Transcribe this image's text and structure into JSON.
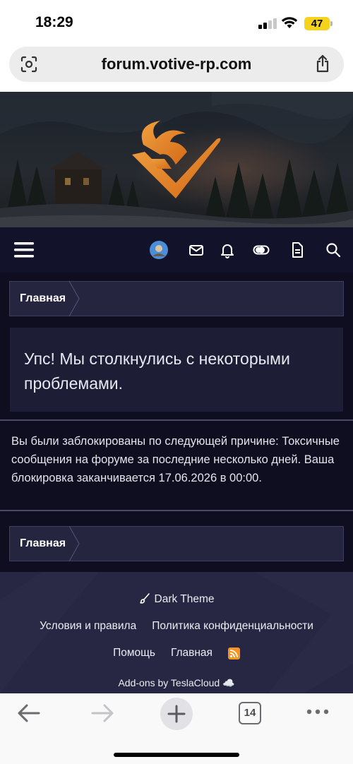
{
  "status_bar": {
    "time": "18:29",
    "battery": "47",
    "battery_color": "#f5d21c"
  },
  "browser": {
    "url": "forum.votive-rp.com",
    "left_icon": "page-scan-icon",
    "right_icon": "share-icon",
    "tab_count": "14"
  },
  "site": {
    "logo": "phoenix-shield-logo",
    "logo_color": "#e8862a",
    "nav_icons": [
      "menu-icon",
      "avatar",
      "envelope-icon",
      "bell-icon",
      "theme-toggle-icon",
      "document-icon",
      "search-icon"
    ],
    "breadcrumb_top": "Главная",
    "error_title": "Упс! Мы столкнулись с некоторыми проблемами.",
    "ban_message": "Вы были заблокированы по следующей причине: Токсичные сообщения на форуме за последние несколько дней. Ваша блокировка заканчивается 17.06.2026 в 00:00.",
    "breadcrumb_bottom": "Главная"
  },
  "footer": {
    "theme_label": "Dark Theme",
    "terms": "Условия и правила",
    "privacy": "Политика конфиденциальности",
    "help": "Помощь",
    "home": "Главная",
    "addons": "Add-ons by TeslaCloud ☁️"
  }
}
